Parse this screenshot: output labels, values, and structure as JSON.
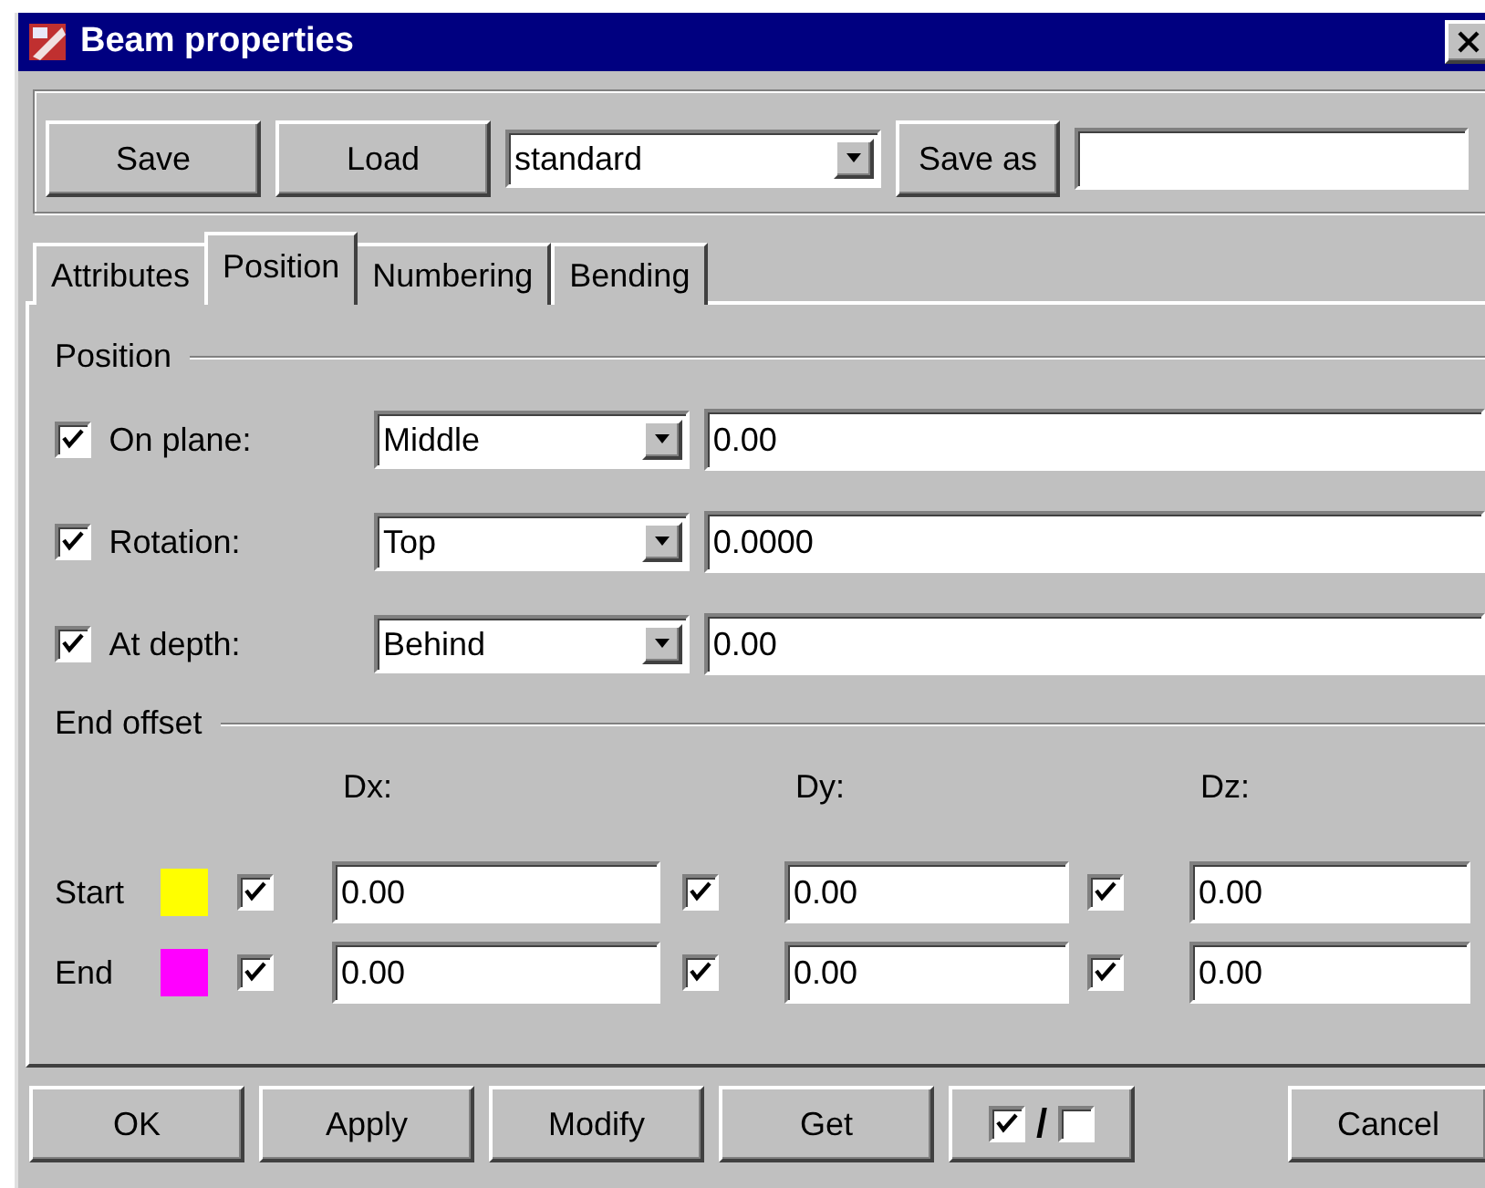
{
  "window": {
    "title": "Beam properties"
  },
  "toolbar": {
    "save": "Save",
    "load": "Load",
    "preset": "standard",
    "save_as": "Save as"
  },
  "tabs": [
    {
      "label": "Attributes",
      "selected": false
    },
    {
      "label": "Position",
      "selected": true
    },
    {
      "label": "Numbering",
      "selected": false
    },
    {
      "label": "Bending",
      "selected": false
    }
  ],
  "position": {
    "heading": "Position",
    "rows": [
      {
        "label": "On plane:",
        "checked": true,
        "option": "Middle",
        "value": "0.00"
      },
      {
        "label": "Rotation:",
        "checked": true,
        "option": "Top",
        "value": "0.0000"
      },
      {
        "label": "At depth:",
        "checked": true,
        "option": "Behind",
        "value": "0.00"
      }
    ]
  },
  "end_offset": {
    "heading": "End offset",
    "columns": [
      "Dx:",
      "Dy:",
      "Dz:"
    ],
    "rows": [
      {
        "label": "Start",
        "color": "#ffff00",
        "fields": [
          {
            "checked": true,
            "value": "0.00"
          },
          {
            "checked": true,
            "value": "0.00"
          },
          {
            "checked": true,
            "value": "0.00"
          }
        ]
      },
      {
        "label": "End",
        "color": "#ff00ff",
        "fields": [
          {
            "checked": true,
            "value": "0.00"
          },
          {
            "checked": true,
            "value": "0.00"
          },
          {
            "checked": true,
            "value": "0.00"
          }
        ]
      }
    ]
  },
  "buttons": [
    {
      "label": "OK"
    },
    {
      "label": "Apply"
    },
    {
      "label": "Modify"
    },
    {
      "label": "Get"
    }
  ],
  "toggle": {
    "separator": "/",
    "left_checked": true,
    "right_checked": false
  },
  "cancel": "Cancel"
}
